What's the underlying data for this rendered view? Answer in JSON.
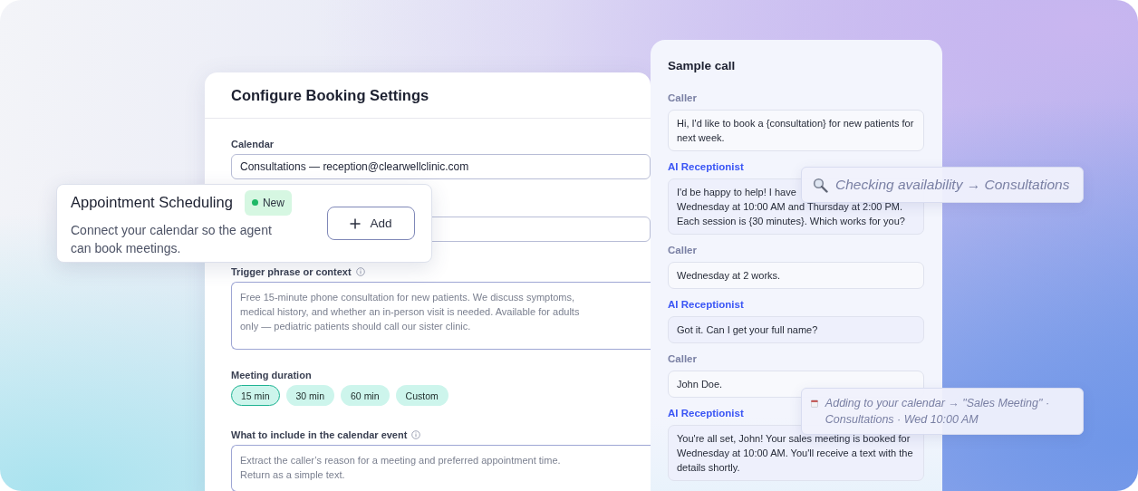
{
  "booking_settings": {
    "title": "Configure Booking Settings",
    "calendar": {
      "label": "Calendar",
      "info": false,
      "value": "Consultations — reception@clearwellclinic.com"
    },
    "trigger": {
      "label": "Trigger phrase or context",
      "info": true,
      "placeholder": "Free 15-minute phone consultation for new patients. We discuss symptoms,\nmedical history, and whether an in-person visit is needed. Available for adults\nonly — pediatric patients should call our sister clinic."
    },
    "duration": {
      "label": "Meeting duration",
      "options": [
        {
          "label": "15 min",
          "selected": true
        },
        {
          "label": "30 min",
          "selected": false
        },
        {
          "label": "60 min",
          "selected": false
        },
        {
          "label": "Custom",
          "selected": false
        }
      ]
    },
    "event_details": {
      "label": "What to include in the calendar event",
      "info": true,
      "placeholder": "Extract the caller’s reason for a meeting and preferred appointment time.\nReturn as a simple text."
    }
  },
  "integration_card": {
    "title": "Appointment Scheduling",
    "badge": "New",
    "description": "Connect your calendar so the agent can book meetings.",
    "button": "Add"
  },
  "sample_call": {
    "title": "Sample call",
    "messages": [
      {
        "kind": "caller",
        "speaker": "Caller",
        "text": "Hi, I'd like to book a {consultation} for new patients for next week."
      },
      {
        "kind": "ai",
        "speaker": "AI Receptionist",
        "text": "I'd be happy to help! I have\nWednesday at 10:00 AM and Thursday at 2:00 PM.\nEach session is {30 minutes}. Which works for you?"
      },
      {
        "kind": "caller",
        "speaker": "Caller",
        "text": "Wednesday at 2 works."
      },
      {
        "kind": "ai",
        "speaker": "AI Receptionist",
        "text": "Got it. Can I get your full name?"
      },
      {
        "kind": "caller",
        "speaker": "Caller",
        "text": "John Doe."
      },
      {
        "kind": "ai",
        "speaker": "AI Receptionist",
        "text": "You're all set, John! Your sales meeting is booked for Wednesday at 10:00 AM. You'll receive a text with the details shortly."
      }
    ]
  },
  "tool_events": [
    {
      "kind": "search",
      "text": "Checking availability → Consultations"
    },
    {
      "kind": "calendar",
      "text": "Adding to your calendar → \"Sales Meeting\" · Consultations · Wed 10:00 AM"
    }
  ]
}
